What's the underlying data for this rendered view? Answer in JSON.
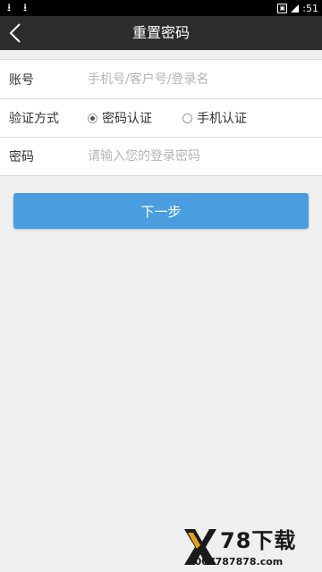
{
  "status_bar": {
    "time": ":51"
  },
  "header": {
    "title": "重置密码"
  },
  "form": {
    "account": {
      "label": "账号",
      "placeholder": "手机号/客户号/登录名"
    },
    "verify": {
      "label": "验证方式",
      "options": [
        {
          "label": "密码认证",
          "selected": true
        },
        {
          "label": "手机认证",
          "selected": false
        }
      ]
    },
    "password": {
      "label": "密码",
      "placeholder": "请输入您的登录密码"
    }
  },
  "next_button": {
    "label": "下一步"
  },
  "watermark": {
    "title": "78下载",
    "url": "4007787878.com"
  },
  "colors": {
    "primary_button": "#4a9ee0",
    "nav_bar": "#2c2c2e",
    "background": "#efefef"
  }
}
